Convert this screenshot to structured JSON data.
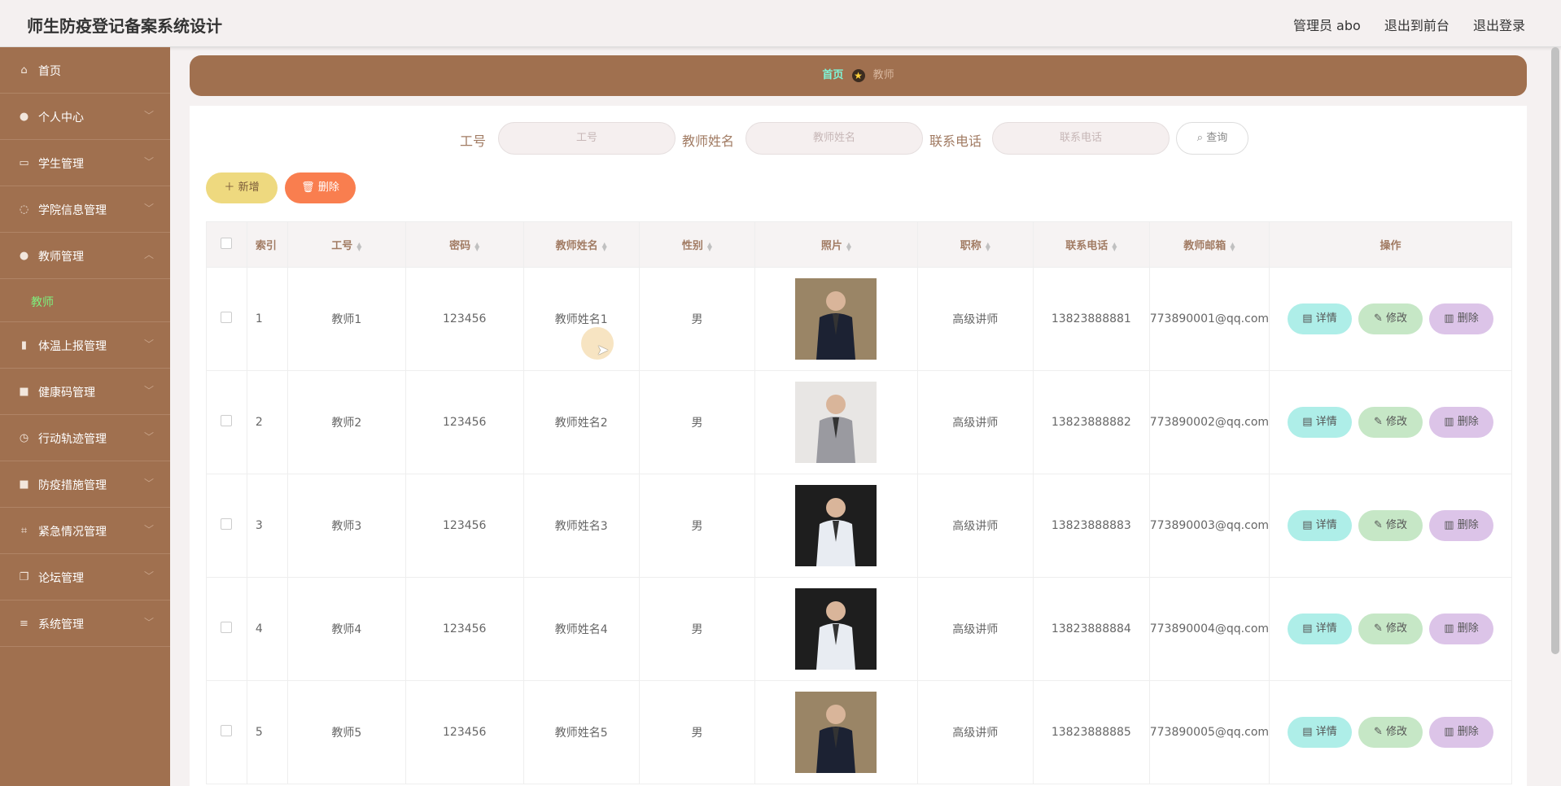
{
  "header": {
    "title": "师生防疫登记备案系统设计",
    "user_label": "管理员 abo",
    "to_front": "退出到前台",
    "logout": "退出登录"
  },
  "sidebar": {
    "items": [
      {
        "label": "首页",
        "icon": "home-icon",
        "glyph": "⌂"
      },
      {
        "label": "个人中心",
        "icon": "user-icon",
        "glyph": "●"
      },
      {
        "label": "学生管理",
        "icon": "card-icon",
        "glyph": "▭"
      },
      {
        "label": "学院信息管理",
        "icon": "power-icon",
        "glyph": "◌"
      },
      {
        "label": "教师管理",
        "icon": "user-icon",
        "glyph": "●"
      },
      {
        "label": "体温上报管理",
        "icon": "bar-chart-icon",
        "glyph": "▮"
      },
      {
        "label": "健康码管理",
        "icon": "briefcase-icon",
        "glyph": "■"
      },
      {
        "label": "行动轨迹管理",
        "icon": "clock-icon",
        "glyph": "◷"
      },
      {
        "label": "防疫措施管理",
        "icon": "box-icon",
        "glyph": "■"
      },
      {
        "label": "紧急情况管理",
        "icon": "crop-icon",
        "glyph": "⌗"
      },
      {
        "label": "论坛管理",
        "icon": "copy-icon",
        "glyph": "❐"
      },
      {
        "label": "系统管理",
        "icon": "menu-icon",
        "glyph": "≡"
      }
    ],
    "submenu_label": "教师"
  },
  "breadcrumb": {
    "home": "首页",
    "current": "教师"
  },
  "search": {
    "labels": [
      "工号",
      "教师姓名",
      "联系电话"
    ],
    "placeholders": [
      "工号",
      "教师姓名",
      "联系电话"
    ],
    "button": "查询"
  },
  "actions": {
    "add": "新增",
    "delete": "删除"
  },
  "table": {
    "headers": [
      "索引",
      "工号",
      "密码",
      "教师姓名",
      "性别",
      "照片",
      "职称",
      "联系电话",
      "教师邮箱",
      "操作"
    ],
    "rows": [
      {
        "idx": "1",
        "no": "教师1",
        "pwd": "123456",
        "name": "教师姓名1",
        "sex": "男",
        "title": "高级讲师",
        "phone": "13823888881",
        "email": "773890001@qq.com"
      },
      {
        "idx": "2",
        "no": "教师2",
        "pwd": "123456",
        "name": "教师姓名2",
        "sex": "男",
        "title": "高级讲师",
        "phone": "13823888882",
        "email": "773890002@qq.com"
      },
      {
        "idx": "3",
        "no": "教师3",
        "pwd": "123456",
        "name": "教师姓名3",
        "sex": "男",
        "title": "高级讲师",
        "phone": "13823888883",
        "email": "773890003@qq.com"
      },
      {
        "idx": "4",
        "no": "教师4",
        "pwd": "123456",
        "name": "教师姓名4",
        "sex": "男",
        "title": "高级讲师",
        "phone": "13823888884",
        "email": "773890004@qq.com"
      },
      {
        "idx": "5",
        "no": "教师5",
        "pwd": "123456",
        "name": "教师姓名5",
        "sex": "男",
        "title": "高级讲师",
        "phone": "13823888885",
        "email": "773890005@qq.com"
      }
    ],
    "op_labels": {
      "detail": "详情",
      "edit": "修改",
      "delete": "删除"
    }
  },
  "colors": {
    "sidebar": "#a0704f",
    "accent": "#a17b63",
    "submenu_active": "#7ef07e"
  }
}
